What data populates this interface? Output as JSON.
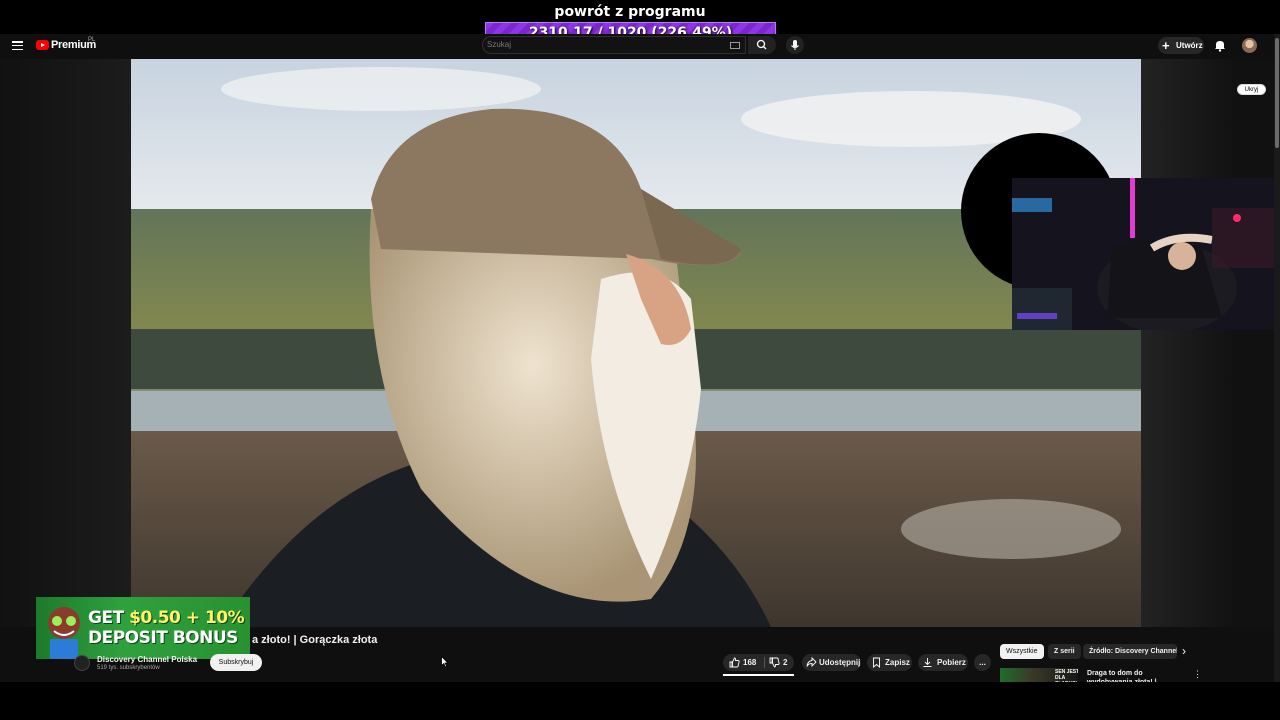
{
  "stream_overlay": {
    "title": "powrót z programu",
    "progress_text": "2310.17 / 1020 (226.49%)",
    "progress_fraction": 1.0,
    "bar_color": "#7c2bd1"
  },
  "youtube": {
    "logo": "Premium",
    "region": "PL",
    "search": {
      "placeholder": "Szukaj"
    },
    "create_label": "Utwórz",
    "icons": [
      "menu-icon",
      "keyboard-icon",
      "search-icon",
      "mic-icon",
      "plus-icon",
      "bell-icon"
    ]
  },
  "video": {
    "hide_label": "Ukryj",
    "title_visible": "a złoto! | Gorączka złota",
    "channel_name": "Discovery Channel Polska",
    "subscribers": "519 tys. subskrybentów",
    "subscribe_label": "Subskrybuj"
  },
  "actions": {
    "likes": "168",
    "dislikes": "2",
    "share": "Udostępnij",
    "save": "Zapisz",
    "download": "Pobierz",
    "more": "..."
  },
  "sidebar": {
    "chips": [
      "Wszystkie",
      "Z serii",
      "Źródło: Discovery Channel Polska"
    ],
    "next_icon": "chevron-right-icon",
    "recommendation": {
      "thumb_text": "SEN JEST DLA SŁABYCH",
      "title": "Draga to dom do wydobywania złota! | Gorączka złota"
    }
  },
  "ad": {
    "line1_prefix": "GET ",
    "line1_highlight": "$0.50 + 10%",
    "line2": "DEPOSIT BONUS"
  },
  "colors": {
    "youtube_red": "#ff0000",
    "page_bg": "#0f0f0f",
    "ad_green": "#2ea13d"
  }
}
